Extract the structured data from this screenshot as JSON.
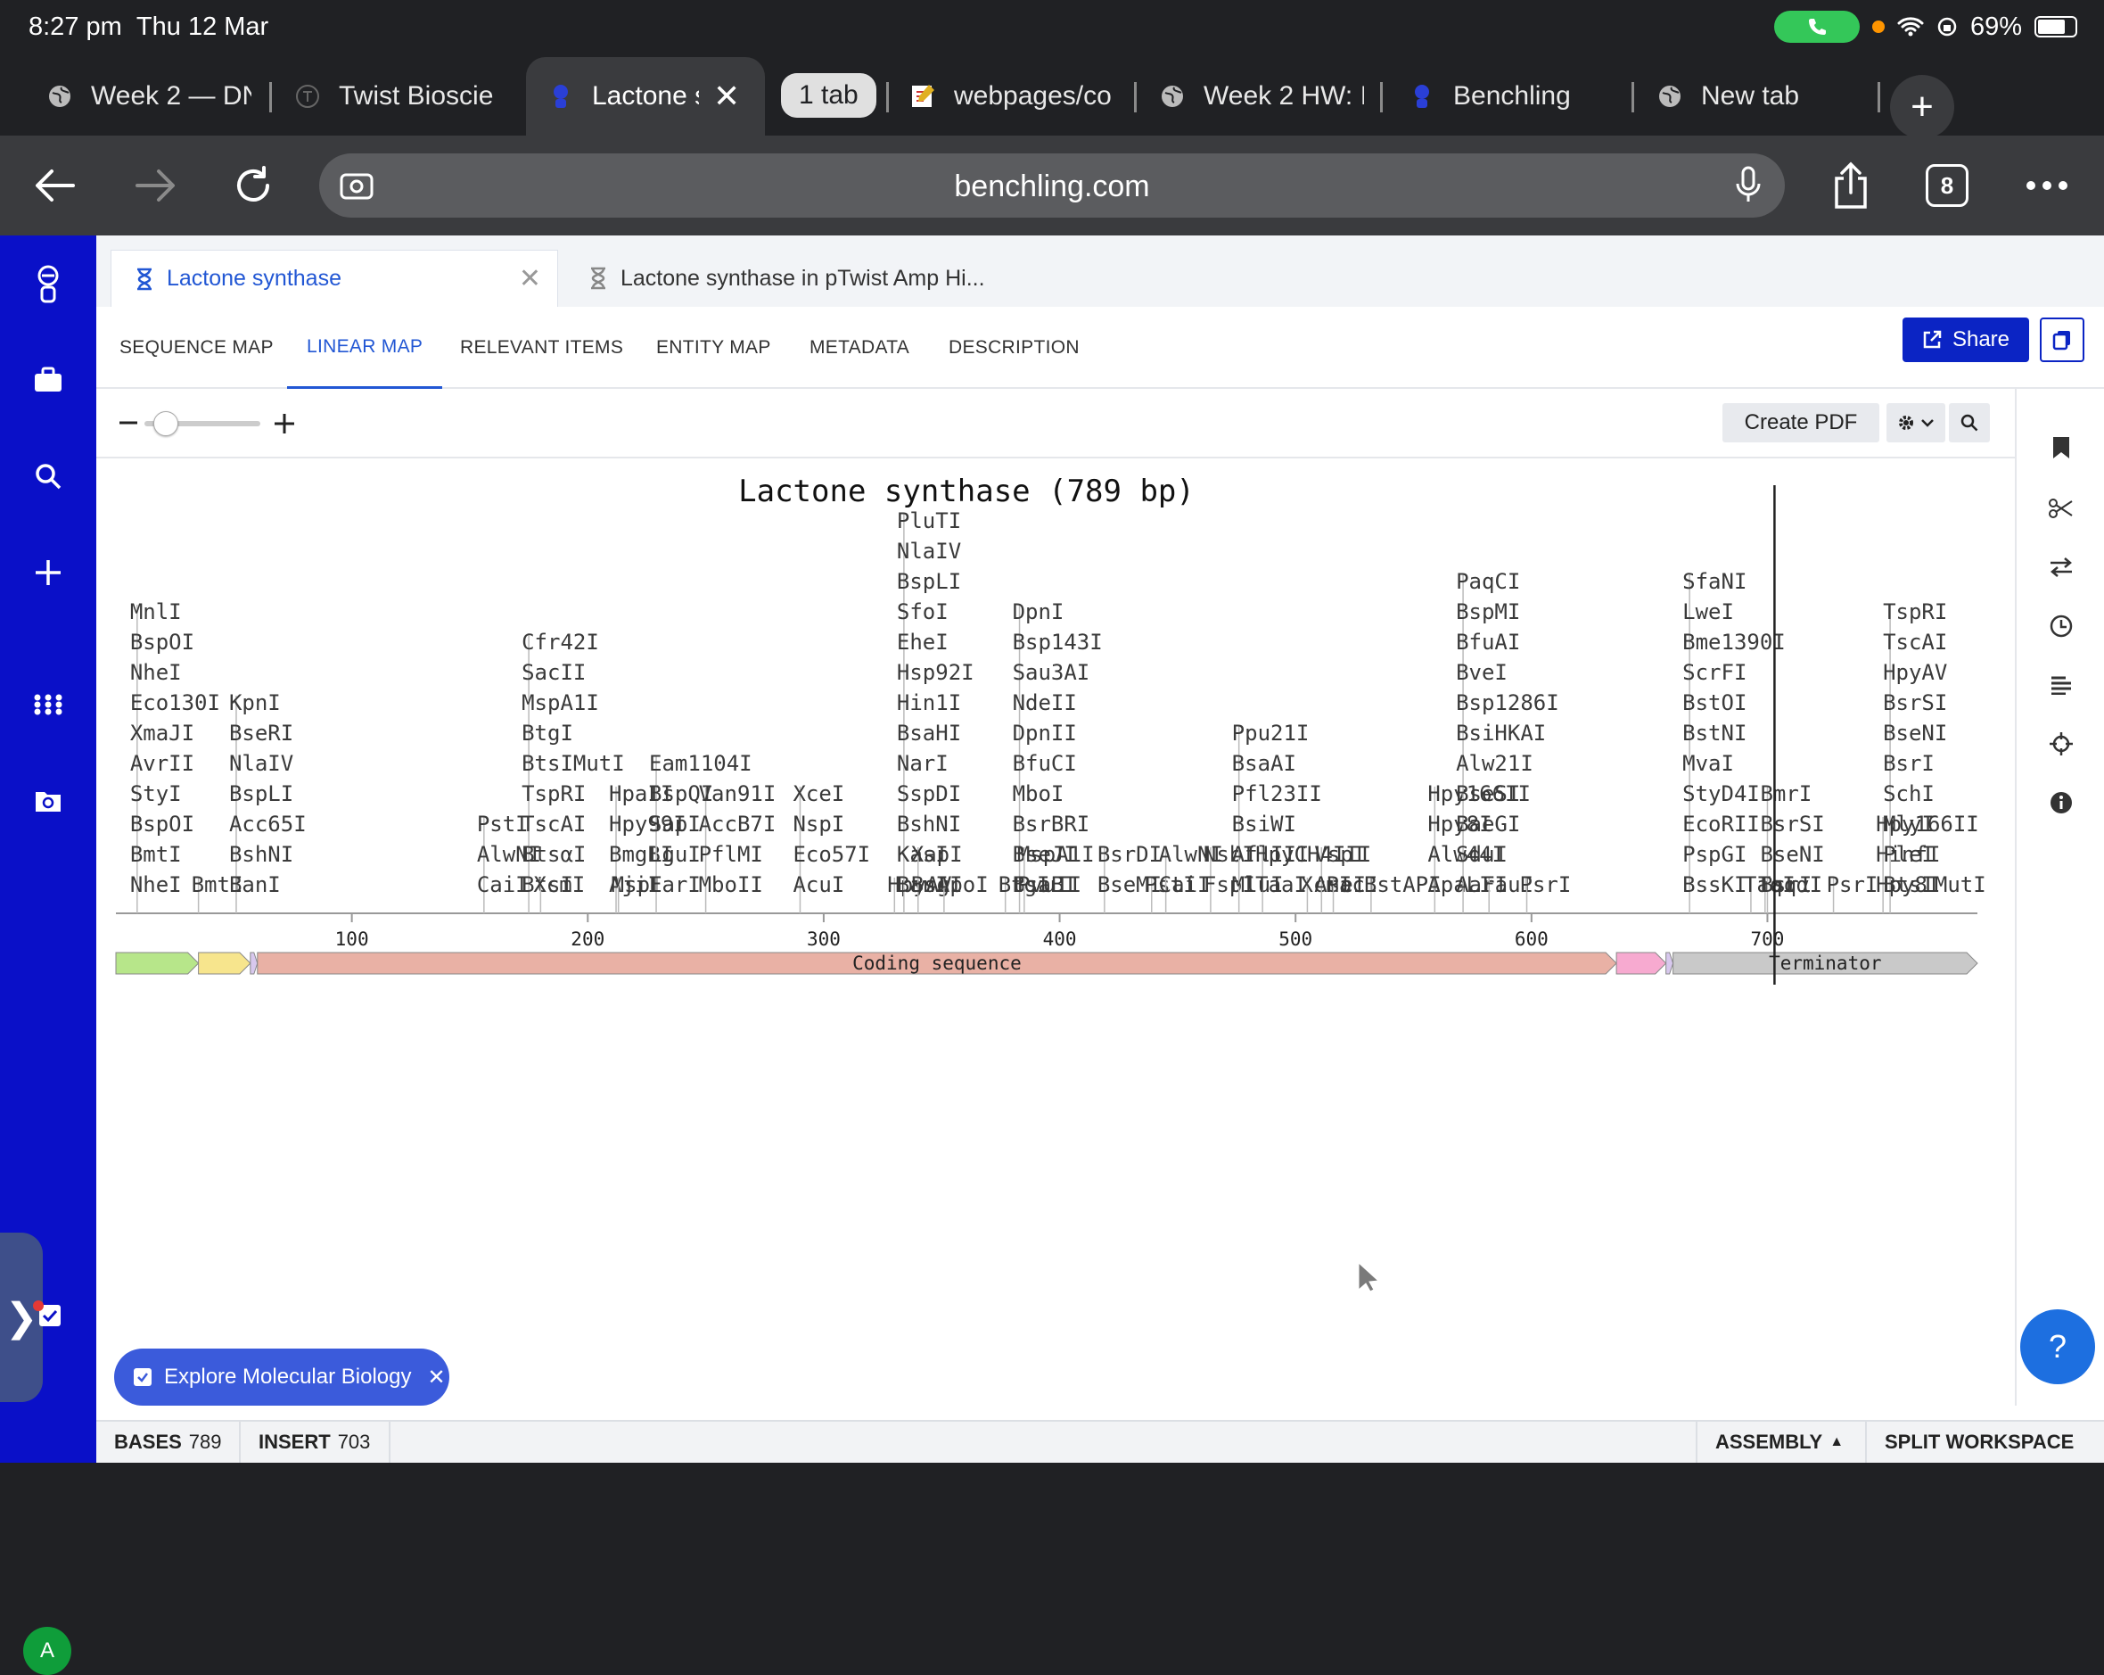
{
  "status_bar": {
    "time": "8:27 pm",
    "date": "Thu 12 Mar",
    "battery": "69%"
  },
  "browser_tabs": [
    {
      "title": "Week 2 — DN",
      "icon": "globe-icon"
    },
    {
      "title": "Twist Bioscie",
      "icon": "twist-favicon-icon"
    },
    {
      "title": "Lactone s",
      "icon": "benchling-favicon-icon",
      "active": true
    },
    {
      "title": "1 tab",
      "icon": "tab-group"
    },
    {
      "title": "webpages/co",
      "icon": "notepad-icon"
    },
    {
      "title": "Week 2 HW: I",
      "icon": "globe-icon"
    },
    {
      "title": "Benchling",
      "icon": "benchling-favicon-icon"
    },
    {
      "title": "New tab",
      "icon": "globe-icon"
    }
  ],
  "toolbar": {
    "url": "benchling.com",
    "tab_count": "8"
  },
  "doc_tabs": [
    {
      "title": "Lactone synthase",
      "active": true
    },
    {
      "title": "Lactone synthase in pTwist Amp Hi..."
    }
  ],
  "view_tabs": [
    {
      "label": "SEQUENCE MAP"
    },
    {
      "label": "LINEAR MAP",
      "active": true
    },
    {
      "label": "RELEVANT ITEMS"
    },
    {
      "label": "ENTITY MAP"
    },
    {
      "label": "METADATA"
    },
    {
      "label": "DESCRIPTION"
    }
  ],
  "actions": {
    "share_label": "Share",
    "create_pdf_label": "Create PDF"
  },
  "zoom": {
    "level": 0.1
  },
  "map": {
    "title": "Lactone synthase (789 bp)",
    "total_bp": 789,
    "cursor_bp": 703,
    "axis_ticks": [
      100,
      200,
      300,
      400,
      500,
      600,
      700
    ],
    "features": [
      {
        "label": "",
        "start": 1,
        "end": 35,
        "color": "#b7e68a",
        "direction": "forward"
      },
      {
        "label": "",
        "start": 36,
        "end": 57,
        "color": "#f7e58d",
        "direction": "forward"
      },
      {
        "label": "",
        "start": 58,
        "end": 60,
        "color": "#d8c8ee",
        "direction": "forward"
      },
      {
        "label": "Coding sequence",
        "start": 61,
        "end": 636,
        "color": "#e9b1a5",
        "direction": "forward"
      },
      {
        "label": "",
        "start": 637,
        "end": 657,
        "color": "#f7aad0",
        "direction": "forward"
      },
      {
        "label": "",
        "start": 658,
        "end": 660,
        "color": "#d8c8ee",
        "direction": "forward"
      },
      {
        "label": "Terminator",
        "start": 661,
        "end": 789,
        "color": "#c9c9c9",
        "direction": "forward"
      }
    ],
    "enzyme_groups": [
      {
        "pos": 9,
        "labels": [
          "NheI",
          "BmtI",
          "BspOI",
          "StyI",
          "AvrII",
          "XmaJI",
          "Eco130I",
          "NheI",
          "BspOI",
          "MnlI"
        ]
      },
      {
        "pos": 35,
        "labels": [
          "BmtI"
        ]
      },
      {
        "pos": 51,
        "labels": [
          "BanI",
          "BshNI",
          "Acc65I",
          "BspLI",
          "NlaIV",
          "BseRI",
          "KpnI"
        ]
      },
      {
        "pos": 156,
        "labels": [
          "CaiI",
          "AlwNI",
          "PstI"
        ]
      },
      {
        "pos": 175,
        "labels": [
          "BtsI",
          "BtsαI",
          "TscAI",
          "TspRI",
          "BtsIMutI",
          "BtgI",
          "MspA1I",
          "SacII",
          "Cfr42I"
        ]
      },
      {
        "pos": 180,
        "labels": [
          "XcmI"
        ]
      },
      {
        "pos": 212,
        "labels": [
          "AjiI",
          "BmgBI",
          "Hpy99I",
          "HpaII"
        ]
      },
      {
        "pos": 213,
        "labels": [
          "MspI"
        ]
      },
      {
        "pos": 229,
        "labels": [
          "EarI",
          "LguI",
          "SapI",
          "BspQI",
          "Eam1104I"
        ]
      },
      {
        "pos": 250,
        "labels": [
          "MboII",
          "PflMI",
          "AccB7I",
          "Van91I"
        ]
      },
      {
        "pos": 290,
        "labels": [
          "AcuI",
          "Eco57I",
          "NspI",
          "XceI"
        ]
      },
      {
        "pos": 330,
        "labels": [
          "HpyAV"
        ]
      },
      {
        "pos": 334,
        "labels": [
          "BanI",
          "KasI",
          "BshNI",
          "SspDI",
          "NarI",
          "BsaHI",
          "Hin1I",
          "Hsp92I",
          "EheI",
          "SfoI",
          "BspLI",
          "NlaIV",
          "PluTI"
        ]
      },
      {
        "pos": 340,
        "labels": [
          "BsgI",
          "XapI"
        ]
      },
      {
        "pos": 351,
        "labels": [
          "ApoI"
        ]
      },
      {
        "pos": 377,
        "labels": [
          "BtgI"
        ]
      },
      {
        "pos": 383,
        "labels": [
          "BsaBI",
          "BseJI",
          "BsrBRI",
          "MboI",
          "BfuCI",
          "DpnII",
          "NdeII",
          "Sau3AI",
          "Bsp143I",
          "DpnI"
        ]
      },
      {
        "pos": 385,
        "labels": [
          "PvuII",
          "MspA1I"
        ]
      },
      {
        "pos": 419,
        "labels": [
          "BseMI",
          "BsrDI"
        ]
      },
      {
        "pos": 439,
        "labels": [
          "PstI"
        ]
      },
      {
        "pos": 445,
        "labels": [
          "CaiI",
          "AlwNI"
        ]
      },
      {
        "pos": 464,
        "labels": [
          "FspI",
          "NsbI"
        ]
      },
      {
        "pos": 476,
        "labels": [
          "MluI",
          "AflIII",
          "BsiWI",
          "Pfl23II",
          "BsaAI",
          "Ppu21I"
        ]
      },
      {
        "pos": 486,
        "labels": [
          "TaaI",
          "HpyCH4III"
        ]
      },
      {
        "pos": 505,
        "labels": [
          "XcmI"
        ]
      },
      {
        "pos": 511,
        "labels": [
          "AseI",
          "VspI"
        ]
      },
      {
        "pos": 516,
        "labels": [
          "PacI"
        ]
      },
      {
        "pos": 532,
        "labels": [
          "BstAPI"
        ]
      },
      {
        "pos": 559,
        "labels": [
          "ApaLI",
          "Alw44I",
          "Hpy8I",
          "Hpy166II"
        ]
      },
      {
        "pos": 571,
        "labels": [
          "AarI",
          "SduI",
          "BaeGI",
          "BseSI",
          "Alw21I",
          "BsiHKAI",
          "Bsp1286I",
          "BveI",
          "BfuAI",
          "BspMI",
          "PaqCI"
        ]
      },
      {
        "pos": 582,
        "labels": [
          "FauI"
        ]
      },
      {
        "pos": 598,
        "labels": [
          "PsrI"
        ]
      },
      {
        "pos": 667,
        "labels": [
          "BssKI",
          "PspGI",
          "EcoRII",
          "StyD4I",
          "MvaI",
          "BstNI",
          "BstOI",
          "ScrFI",
          "Bme1390I",
          "LweI",
          "SfaNI"
        ]
      },
      {
        "pos": 693,
        "labels": [
          "TaqI"
        ]
      },
      {
        "pos": 699,
        "labels": [
          "TaqαI"
        ]
      },
      {
        "pos": 700,
        "labels": [
          "BsrI",
          "BseNI",
          "BsrSI",
          "BmrI"
        ]
      },
      {
        "pos": 728,
        "labels": [
          "PsrI"
        ]
      },
      {
        "pos": 749,
        "labels": [
          "Hpy8I",
          "HinfI",
          "Hpy166II"
        ]
      },
      {
        "pos": 752,
        "labels": [
          "BtsIMutI",
          "PleI",
          "MlyI",
          "SchI",
          "BsrI",
          "BseNI",
          "BsrSI",
          "HpyAV",
          "TscAI",
          "TspRI"
        ]
      }
    ]
  },
  "explore_pill": {
    "label": "Explore Molecular Biology"
  },
  "footer": {
    "bases_label": "BASES",
    "bases_value": "789",
    "insert_label": "INSERT",
    "insert_value": "703",
    "assembly_label": "ASSEMBLY",
    "split_label": "SPLIT WORKSPACE"
  },
  "colors": {
    "sidebar": "#0a10c8",
    "accent": "#2257d4",
    "share": "#0b24c4"
  }
}
